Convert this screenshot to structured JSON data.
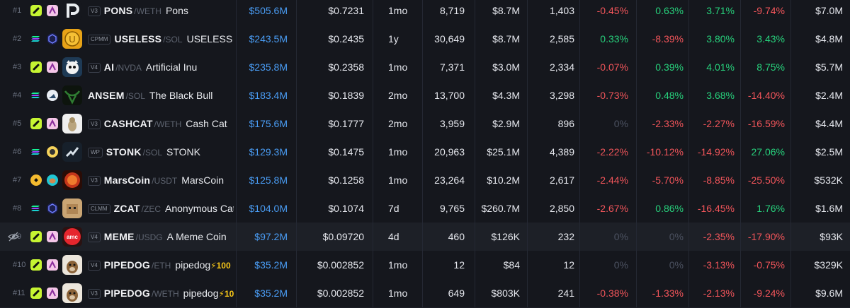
{
  "colors": {
    "background": "#111318",
    "positive": "#27d17c",
    "negative": "#f2555a",
    "market_cap": "#4a9df5",
    "zero": "#4b5160"
  },
  "icons": {
    "hidden_row": "eye-off-icon"
  },
  "rows": [
    {
      "rank": "#1",
      "chain": "pump-chain-icon",
      "dex": "pumpswap-icon",
      "avatar": "pons-logo",
      "version": "V3",
      "symbol": "PONS",
      "quote": "/WETH",
      "name": "Pons",
      "boost": "",
      "market_cap": "$505.6M",
      "price": "$0.7231",
      "age": "1mo",
      "txns": "8,719",
      "volume": "$8.7M",
      "makers": "1,403",
      "ch5m": "-0.45%",
      "ch1h": "0.63%",
      "ch6h": "3.71%",
      "ch24h": "-9.74%",
      "liquidity": "$7.0M"
    },
    {
      "rank": "#2",
      "chain": "solana-icon",
      "dex": "raydium-icon",
      "avatar": "useless-logo",
      "version": "CPMM",
      "symbol": "USELESS",
      "quote": "/SOL",
      "name": "USELESS CO",
      "boost": "",
      "market_cap": "$243.5M",
      "price": "$0.2435",
      "age": "1y",
      "txns": "30,649",
      "volume": "$8.7M",
      "makers": "2,585",
      "ch5m": "0.33%",
      "ch1h": "-8.39%",
      "ch6h": "3.80%",
      "ch24h": "3.43%",
      "liquidity": "$4.8M"
    },
    {
      "rank": "#3",
      "chain": "pump-chain-icon",
      "dex": "pumpswap-icon",
      "avatar": "ai-cat-logo",
      "version": "V4",
      "symbol": "AI",
      "quote": "/NVDA",
      "name": "Artificial Inu",
      "boost": "",
      "market_cap": "$235.8M",
      "price": "$0.2358",
      "age": "1mo",
      "txns": "7,371",
      "volume": "$3.0M",
      "makers": "2,334",
      "ch5m": "-0.07%",
      "ch1h": "0.39%",
      "ch6h": "4.01%",
      "ch24h": "8.75%",
      "liquidity": "$5.7M"
    },
    {
      "rank": "#4",
      "chain": "solana-icon",
      "dex": "meteora-icon",
      "avatar": "black-bull-logo",
      "version": "",
      "symbol": "ANSEM",
      "quote": "/SOL",
      "name": "The Black Bull",
      "boost": "",
      "market_cap": "$183.4M",
      "price": "$0.1839",
      "age": "2mo",
      "txns": "13,700",
      "volume": "$4.3M",
      "makers": "3,298",
      "ch5m": "-0.73%",
      "ch1h": "0.48%",
      "ch6h": "3.68%",
      "ch24h": "-14.40%",
      "liquidity": "$2.4M"
    },
    {
      "rank": "#5",
      "chain": "pump-chain-icon",
      "dex": "pumpswap-icon",
      "avatar": "cash-cat-logo",
      "version": "V3",
      "symbol": "CASHCAT",
      "quote": "/WETH",
      "name": "Cash Cat",
      "boost": "",
      "market_cap": "$175.6M",
      "price": "$0.1777",
      "age": "2mo",
      "txns": "3,959",
      "volume": "$2.9M",
      "makers": "896",
      "ch5m": "0%",
      "ch1h": "-2.33%",
      "ch6h": "-2.27%",
      "ch24h": "-16.59%",
      "liquidity": "$4.4M"
    },
    {
      "rank": "#6",
      "chain": "solana-icon",
      "dex": "orca-icon",
      "avatar": "stonk-logo",
      "version": "WP",
      "symbol": "STONK",
      "quote": "/SOL",
      "name": "STONK",
      "boost": "",
      "market_cap": "$129.3M",
      "price": "$0.1475",
      "age": "1mo",
      "txns": "20,963",
      "volume": "$25.1M",
      "makers": "4,389",
      "ch5m": "-2.22%",
      "ch1h": "-10.12%",
      "ch6h": "-14.92%",
      "ch24h": "27.06%",
      "liquidity": "$2.5M"
    },
    {
      "rank": "#7",
      "chain": "bnb-icon",
      "dex": "pancake-icon",
      "avatar": "marscoin-logo",
      "version": "V3",
      "symbol": "MarsCoin",
      "quote": "/USDT",
      "name": "MarsCoin",
      "boost": "",
      "market_cap": "$125.8M",
      "price": "$0.1258",
      "age": "1mo",
      "txns": "23,264",
      "volume": "$10.2M",
      "makers": "2,617",
      "ch5m": "-2.44%",
      "ch1h": "-5.70%",
      "ch6h": "-8.85%",
      "ch24h": "-25.50%",
      "liquidity": "$532K"
    },
    {
      "rank": "#8",
      "chain": "solana-icon",
      "dex": "raydium-icon",
      "avatar": "zcat-logo",
      "version": "CLMM",
      "symbol": "ZCAT",
      "quote": "/ZEC",
      "name": "Anonymous Cat",
      "boost": "",
      "market_cap": "$104.0M",
      "price": "$0.1074",
      "age": "7d",
      "txns": "9,765",
      "volume": "$260.7M",
      "makers": "2,850",
      "ch5m": "-2.67%",
      "ch1h": "0.86%",
      "ch6h": "-16.45%",
      "ch24h": "1.76%",
      "liquidity": "$1.6M"
    },
    {
      "rank": "#9",
      "chain": "pump-chain-icon",
      "dex": "pumpswap-icon",
      "avatar": "amc-logo",
      "version": "V4",
      "symbol": "MEME",
      "quote": "/USDG",
      "name": "A Meme Coin",
      "boost": "",
      "market_cap": "$97.2M",
      "price": "$0.09720",
      "age": "4d",
      "txns": "460",
      "volume": "$126K",
      "makers": "232",
      "ch5m": "0%",
      "ch1h": "0%",
      "ch6h": "-2.35%",
      "ch24h": "-17.90%",
      "liquidity": "$93K"
    },
    {
      "rank": "#10",
      "chain": "pump-chain-icon",
      "dex": "pumpswap-icon",
      "avatar": "pipedog-logo",
      "version": "V4",
      "symbol": "PIPEDOG",
      "quote": "/ETH",
      "name": "pipedog",
      "boost": "100",
      "market_cap": "$35.2M",
      "price": "$0.002852",
      "age": "1mo",
      "txns": "12",
      "volume": "$84",
      "makers": "12",
      "ch5m": "0%",
      "ch1h": "0%",
      "ch6h": "-3.13%",
      "ch24h": "-0.75%",
      "liquidity": "$329K"
    },
    {
      "rank": "#11",
      "chain": "pump-chain-icon",
      "dex": "pumpswap-icon",
      "avatar": "pipedog-logo",
      "version": "V3",
      "symbol": "PIPEDOG",
      "quote": "/WETH",
      "name": "pipedog",
      "boost": "100",
      "market_cap": "$35.2M",
      "price": "$0.002852",
      "age": "1mo",
      "txns": "649",
      "volume": "$803K",
      "makers": "241",
      "ch5m": "-0.38%",
      "ch1h": "-1.33%",
      "ch6h": "-2.13%",
      "ch24h": "-9.24%",
      "liquidity": "$9.6M"
    }
  ]
}
